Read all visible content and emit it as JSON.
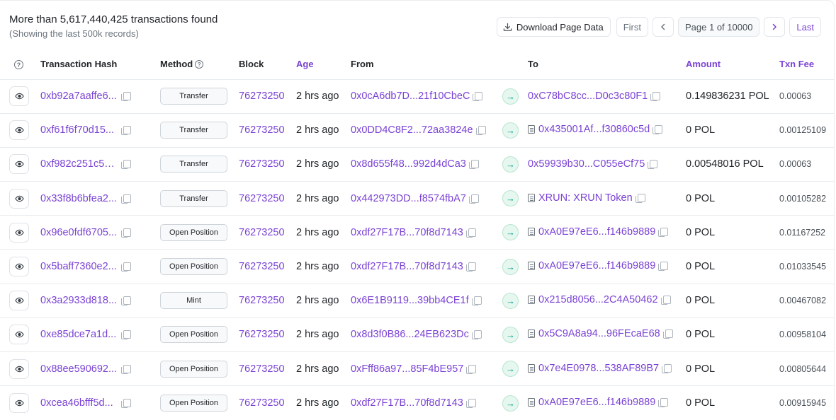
{
  "summary": {
    "main": "More than 5,617,440,425 transactions found",
    "sub": "(Showing the last 500k records)"
  },
  "toolbar": {
    "download_label": "Download Page Data",
    "first_label": "First",
    "page_label": "Page 1 of 10000",
    "last_label": "Last"
  },
  "columns": {
    "hash": "Transaction Hash",
    "method": "Method",
    "block": "Block",
    "age": "Age",
    "from": "From",
    "to": "To",
    "amount": "Amount",
    "fee": "Txn Fee"
  },
  "colors": {
    "accent": "#7a42d4",
    "arrow_bg": "#e6f7f0",
    "arrow_fg": "#00a186"
  },
  "rows": [
    {
      "hash": "0xb92a7aaffe6...",
      "method": "Transfer",
      "block": "76273250",
      "age": "2 hrs ago",
      "from": "0x0cA6db7D...21f10CbeC",
      "to": "0xC78bC8cc...D0c3c80F1",
      "to_contract": false,
      "amount": "0.149836231 POL",
      "fee": "0.00063"
    },
    {
      "hash": "0xf61f6f70d15...",
      "method": "Transfer",
      "block": "76273250",
      "age": "2 hrs ago",
      "from": "0x0DD4C8F2...72aa3824e",
      "to": "0x435001Af...f30860c5d",
      "to_contract": true,
      "amount": "0 POL",
      "fee": "0.00125109"
    },
    {
      "hash": "0xf982c251c57...",
      "method": "Transfer",
      "block": "76273250",
      "age": "2 hrs ago",
      "from": "0x8d655f48...992d4dCa3",
      "to": "0x59939b30...C055eCf75",
      "to_contract": false,
      "amount": "0.00548016 POL",
      "fee": "0.00063"
    },
    {
      "hash": "0x33f8b6bfea2...",
      "method": "Transfer",
      "block": "76273250",
      "age": "2 hrs ago",
      "from": "0x442973DD...f8574fbA7",
      "to": "XRUN: XRUN Token",
      "to_contract": true,
      "amount": "0 POL",
      "fee": "0.00105282"
    },
    {
      "hash": "0x96e0fdf6705...",
      "method": "Open Position",
      "block": "76273250",
      "age": "2 hrs ago",
      "from": "0xdf27F17B...70f8d7143",
      "to": "0xA0E97eE6...f146b9889",
      "to_contract": true,
      "amount": "0 POL",
      "fee": "0.01167252"
    },
    {
      "hash": "0x5baff7360e2...",
      "method": "Open Position",
      "block": "76273250",
      "age": "2 hrs ago",
      "from": "0xdf27F17B...70f8d7143",
      "to": "0xA0E97eE6...f146b9889",
      "to_contract": true,
      "amount": "0 POL",
      "fee": "0.01033545"
    },
    {
      "hash": "0x3a2933d818...",
      "method": "Mint",
      "block": "76273250",
      "age": "2 hrs ago",
      "from": "0x6E1B9119...39bb4CE1f",
      "to": "0x215d8056...2C4A50462",
      "to_contract": true,
      "amount": "0 POL",
      "fee": "0.00467082"
    },
    {
      "hash": "0xe85dce7a1d...",
      "method": "Open Position",
      "block": "76273250",
      "age": "2 hrs ago",
      "from": "0x8d3f0B86...24EB623Dc",
      "to": "0x5C9A8a94...96FEcaE68",
      "to_contract": true,
      "amount": "0 POL",
      "fee": "0.00958104"
    },
    {
      "hash": "0x88ee590692...",
      "method": "Open Position",
      "block": "76273250",
      "age": "2 hrs ago",
      "from": "0xFff86a97...85F4bE957",
      "to": "0x7e4E0978...538AF89B7",
      "to_contract": true,
      "amount": "0 POL",
      "fee": "0.00805644"
    },
    {
      "hash": "0xcea46bfff5d...",
      "method": "Open Position",
      "block": "76273250",
      "age": "2 hrs ago",
      "from": "0xdf27F17B...70f8d7143",
      "to": "0xA0E97eE6...f146b9889",
      "to_contract": true,
      "amount": "0 POL",
      "fee": "0.00915945"
    }
  ]
}
